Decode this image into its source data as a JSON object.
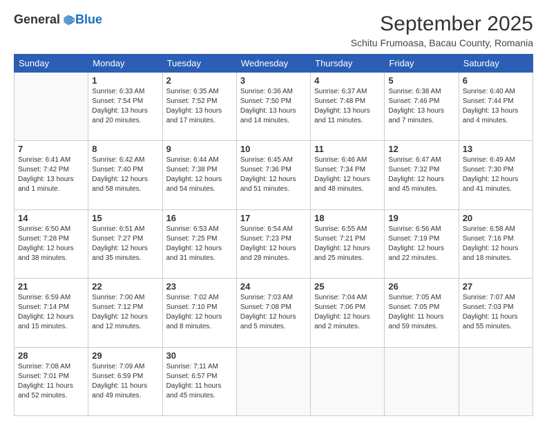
{
  "logo": {
    "general": "General",
    "blue": "Blue"
  },
  "header": {
    "month": "September 2025",
    "location": "Schitu Frumoasa, Bacau County, Romania"
  },
  "weekdays": [
    "Sunday",
    "Monday",
    "Tuesday",
    "Wednesday",
    "Thursday",
    "Friday",
    "Saturday"
  ],
  "weeks": [
    [
      {
        "day": "",
        "info": ""
      },
      {
        "day": "1",
        "info": "Sunrise: 6:33 AM\nSunset: 7:54 PM\nDaylight: 13 hours\nand 20 minutes."
      },
      {
        "day": "2",
        "info": "Sunrise: 6:35 AM\nSunset: 7:52 PM\nDaylight: 13 hours\nand 17 minutes."
      },
      {
        "day": "3",
        "info": "Sunrise: 6:36 AM\nSunset: 7:50 PM\nDaylight: 13 hours\nand 14 minutes."
      },
      {
        "day": "4",
        "info": "Sunrise: 6:37 AM\nSunset: 7:48 PM\nDaylight: 13 hours\nand 11 minutes."
      },
      {
        "day": "5",
        "info": "Sunrise: 6:38 AM\nSunset: 7:46 PM\nDaylight: 13 hours\nand 7 minutes."
      },
      {
        "day": "6",
        "info": "Sunrise: 6:40 AM\nSunset: 7:44 PM\nDaylight: 13 hours\nand 4 minutes."
      }
    ],
    [
      {
        "day": "7",
        "info": "Sunrise: 6:41 AM\nSunset: 7:42 PM\nDaylight: 13 hours\nand 1 minute."
      },
      {
        "day": "8",
        "info": "Sunrise: 6:42 AM\nSunset: 7:40 PM\nDaylight: 12 hours\nand 58 minutes."
      },
      {
        "day": "9",
        "info": "Sunrise: 6:44 AM\nSunset: 7:38 PM\nDaylight: 12 hours\nand 54 minutes."
      },
      {
        "day": "10",
        "info": "Sunrise: 6:45 AM\nSunset: 7:36 PM\nDaylight: 12 hours\nand 51 minutes."
      },
      {
        "day": "11",
        "info": "Sunrise: 6:46 AM\nSunset: 7:34 PM\nDaylight: 12 hours\nand 48 minutes."
      },
      {
        "day": "12",
        "info": "Sunrise: 6:47 AM\nSunset: 7:32 PM\nDaylight: 12 hours\nand 45 minutes."
      },
      {
        "day": "13",
        "info": "Sunrise: 6:49 AM\nSunset: 7:30 PM\nDaylight: 12 hours\nand 41 minutes."
      }
    ],
    [
      {
        "day": "14",
        "info": "Sunrise: 6:50 AM\nSunset: 7:28 PM\nDaylight: 12 hours\nand 38 minutes."
      },
      {
        "day": "15",
        "info": "Sunrise: 6:51 AM\nSunset: 7:27 PM\nDaylight: 12 hours\nand 35 minutes."
      },
      {
        "day": "16",
        "info": "Sunrise: 6:53 AM\nSunset: 7:25 PM\nDaylight: 12 hours\nand 31 minutes."
      },
      {
        "day": "17",
        "info": "Sunrise: 6:54 AM\nSunset: 7:23 PM\nDaylight: 12 hours\nand 28 minutes."
      },
      {
        "day": "18",
        "info": "Sunrise: 6:55 AM\nSunset: 7:21 PM\nDaylight: 12 hours\nand 25 minutes."
      },
      {
        "day": "19",
        "info": "Sunrise: 6:56 AM\nSunset: 7:19 PM\nDaylight: 12 hours\nand 22 minutes."
      },
      {
        "day": "20",
        "info": "Sunrise: 6:58 AM\nSunset: 7:16 PM\nDaylight: 12 hours\nand 18 minutes."
      }
    ],
    [
      {
        "day": "21",
        "info": "Sunrise: 6:59 AM\nSunset: 7:14 PM\nDaylight: 12 hours\nand 15 minutes."
      },
      {
        "day": "22",
        "info": "Sunrise: 7:00 AM\nSunset: 7:12 PM\nDaylight: 12 hours\nand 12 minutes."
      },
      {
        "day": "23",
        "info": "Sunrise: 7:02 AM\nSunset: 7:10 PM\nDaylight: 12 hours\nand 8 minutes."
      },
      {
        "day": "24",
        "info": "Sunrise: 7:03 AM\nSunset: 7:08 PM\nDaylight: 12 hours\nand 5 minutes."
      },
      {
        "day": "25",
        "info": "Sunrise: 7:04 AM\nSunset: 7:06 PM\nDaylight: 12 hours\nand 2 minutes."
      },
      {
        "day": "26",
        "info": "Sunrise: 7:05 AM\nSunset: 7:05 PM\nDaylight: 11 hours\nand 59 minutes."
      },
      {
        "day": "27",
        "info": "Sunrise: 7:07 AM\nSunset: 7:03 PM\nDaylight: 11 hours\nand 55 minutes."
      }
    ],
    [
      {
        "day": "28",
        "info": "Sunrise: 7:08 AM\nSunset: 7:01 PM\nDaylight: 11 hours\nand 52 minutes."
      },
      {
        "day": "29",
        "info": "Sunrise: 7:09 AM\nSunset: 6:59 PM\nDaylight: 11 hours\nand 49 minutes."
      },
      {
        "day": "30",
        "info": "Sunrise: 7:11 AM\nSunset: 6:57 PM\nDaylight: 11 hours\nand 45 minutes."
      },
      {
        "day": "",
        "info": ""
      },
      {
        "day": "",
        "info": ""
      },
      {
        "day": "",
        "info": ""
      },
      {
        "day": "",
        "info": ""
      }
    ]
  ]
}
